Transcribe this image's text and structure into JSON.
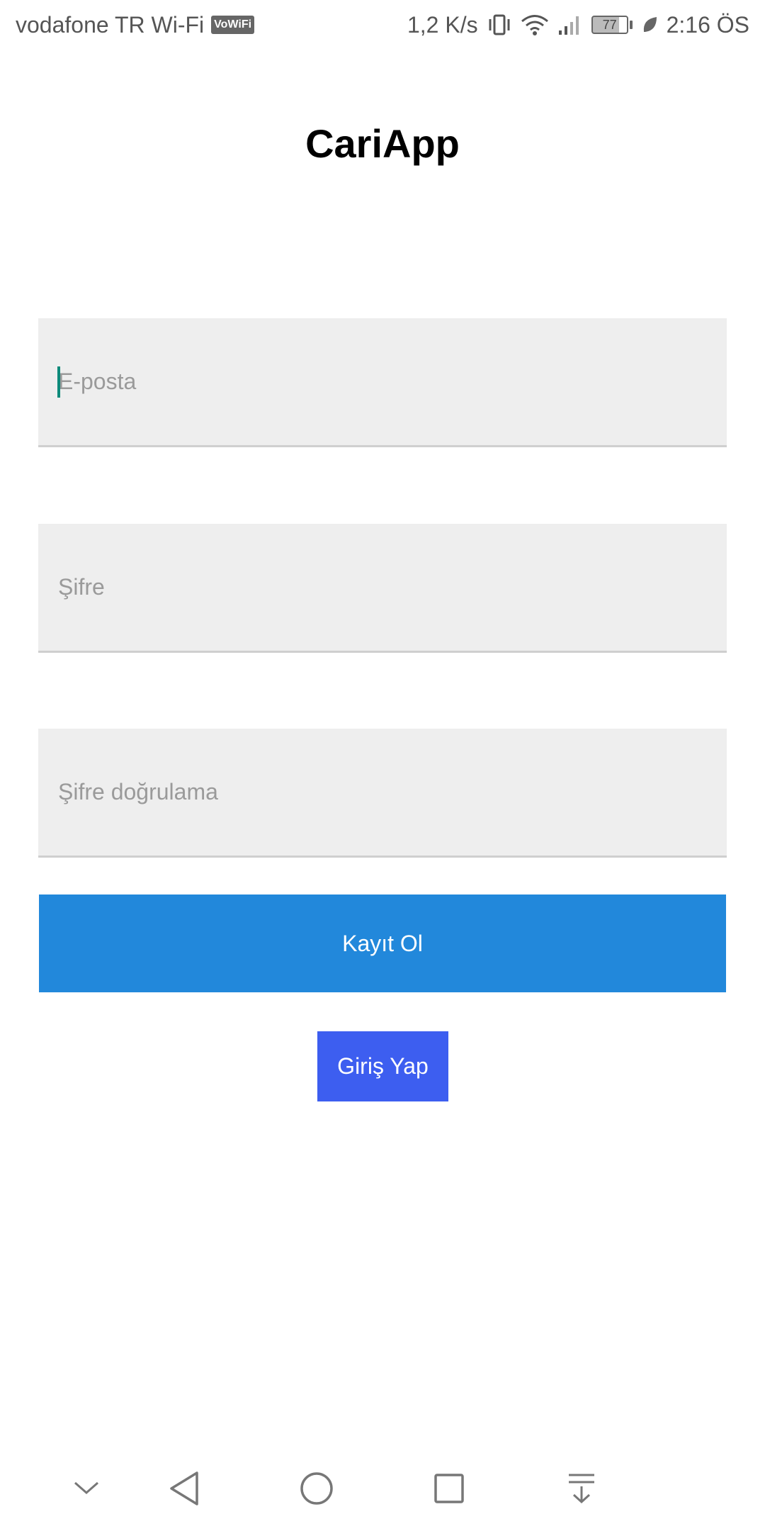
{
  "status_bar": {
    "carrier": "vodafone TR Wi-Fi",
    "vowifi_badge": "VoWiFi",
    "speed": "1,2 K/s",
    "battery": "77",
    "time": "2:16 ÖS",
    "icons": [
      "vibrate-icon",
      "wifi-icon",
      "signal-icon",
      "battery-icon",
      "leaf-icon"
    ]
  },
  "app": {
    "title": "CariApp"
  },
  "form": {
    "email_placeholder": "E-posta",
    "password_placeholder": "Şifre",
    "confirm_placeholder": "Şifre doğrulama",
    "register_label": "Kayıt Ol",
    "login_label": "Giriş Yap"
  },
  "colors": {
    "register_button": "#2288db",
    "login_button": "#3d5ef0",
    "field_background": "#eeeeee",
    "cursor": "#0c8a7a"
  },
  "nav_bar": {
    "icons": [
      "chevron-down-icon",
      "back-icon",
      "home-icon",
      "recents-icon",
      "notification-pull-icon"
    ]
  }
}
